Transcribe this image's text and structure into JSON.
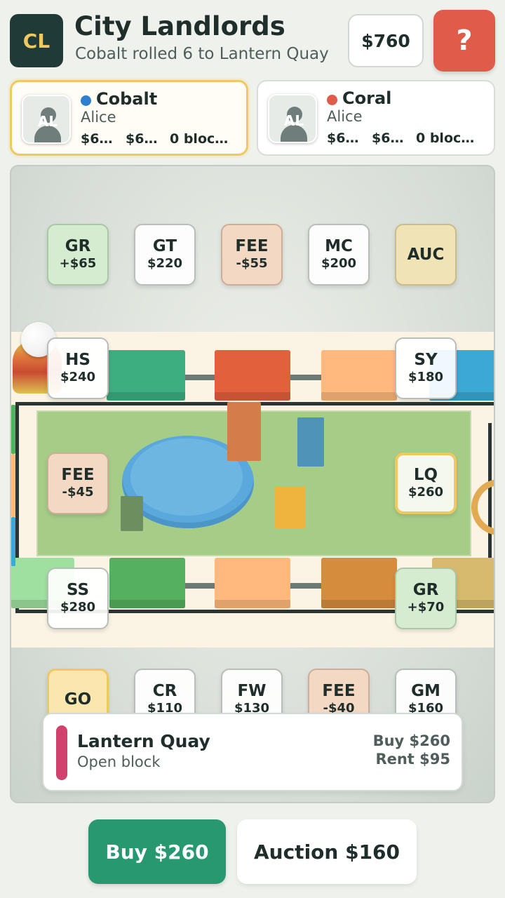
{
  "header": {
    "logo": "CL",
    "title": "City Landlords",
    "subtitle": "Cobalt rolled 6 to Lantern Quay",
    "cash": "$760",
    "help": "?"
  },
  "players": [
    {
      "name": "Cobalt",
      "owner": "Alice",
      "initials": "AL",
      "color": "#2f7fcf",
      "stat1": "$6…",
      "stat2": "$6…",
      "blocks": "0 bloc…",
      "active": true
    },
    {
      "name": "Coral",
      "owner": "Alice",
      "initials": "AL",
      "color": "#e05c4a",
      "stat1": "$6…",
      "stat2": "$6…",
      "blocks": "0 bloc…",
      "active": false
    }
  ],
  "tiles": {
    "top": [
      {
        "code": "GR",
        "val": "+$65",
        "kind": "green"
      },
      {
        "code": "GT",
        "val": "$220",
        "kind": "plain"
      },
      {
        "code": "FEE",
        "val": "-$55",
        "kind": "fee"
      },
      {
        "code": "MC",
        "val": "$200",
        "kind": "plain"
      },
      {
        "code": "AUC",
        "val": "",
        "kind": "auc"
      }
    ],
    "hs": {
      "code": "HS",
      "val": "$240"
    },
    "sy": {
      "code": "SY",
      "val": "$180"
    },
    "fee_left": {
      "code": "FEE",
      "val": "-$45"
    },
    "lq": {
      "code": "LQ",
      "val": "$260"
    },
    "ss": {
      "code": "SS",
      "val": "$280"
    },
    "gr_right": {
      "code": "GR",
      "val": "+$70"
    },
    "bottom": [
      {
        "code": "GO",
        "val": "",
        "kind": "go"
      },
      {
        "code": "CR",
        "val": "$110",
        "kind": "plain"
      },
      {
        "code": "FW",
        "val": "$130",
        "kind": "plain"
      },
      {
        "code": "FEE",
        "val": "-$40",
        "kind": "fee"
      },
      {
        "code": "GM",
        "val": "$160",
        "kind": "plain"
      }
    ]
  },
  "colors": {
    "accent_gold": "#f0c860",
    "buy_green": "#27986f",
    "help_red": "#e05c4a",
    "lantern_quay": "#d0416e"
  },
  "info": {
    "name": "Lantern Quay",
    "status": "Open block",
    "buy": "Buy $260",
    "rent": "Rent $95"
  },
  "actions": {
    "buy": "Buy $260",
    "auction": "Auction $160"
  }
}
